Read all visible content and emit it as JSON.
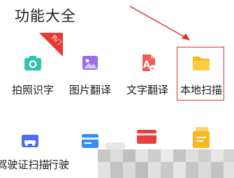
{
  "page": {
    "title": "功能大全"
  },
  "badge": {
    "hot": "热门"
  },
  "features_row1": [
    {
      "label": "拍照识字",
      "icon": "camera-icon"
    },
    {
      "label": "图片翻译",
      "icon": "image-icon"
    },
    {
      "label": "文字翻译",
      "icon": "text-translate-icon"
    },
    {
      "label": "本地扫描",
      "icon": "folder-icon"
    }
  ],
  "features_row2": [
    {
      "label": "驾驶证扫描",
      "icon": "driving-license-icon"
    },
    {
      "label": "行驶",
      "icon": "vehicle-license-icon"
    }
  ],
  "colors": {
    "camera": "#2fc5a8",
    "image": "#9a6cf0",
    "translate": "#f25a5a",
    "folder": "#f9b81c",
    "badge": "#e8352f",
    "annotation": "#d9302c",
    "license": "#4f6cf2"
  }
}
